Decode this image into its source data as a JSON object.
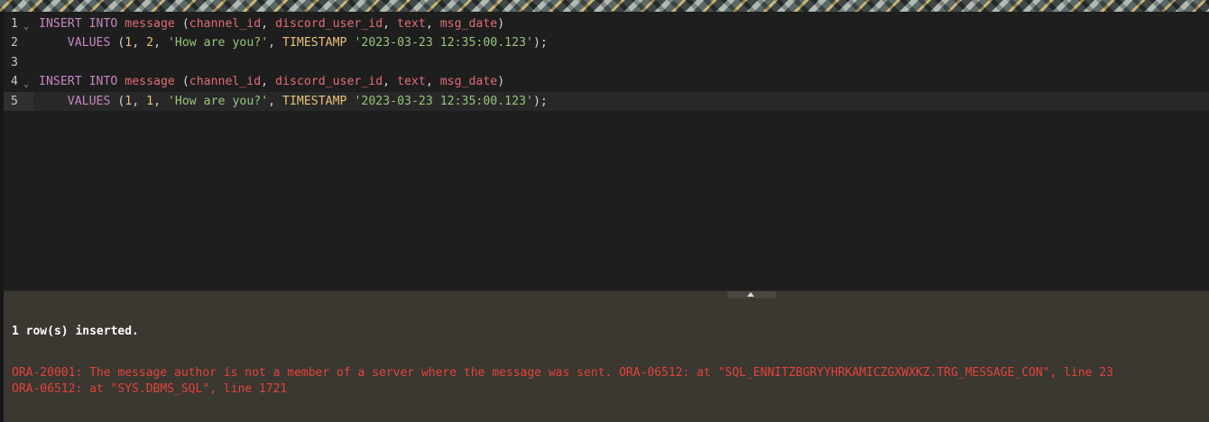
{
  "editor": {
    "lines": [
      {
        "number": "1",
        "fold": "⌄",
        "tokens": [
          "INSERT INTO",
          " ",
          "message",
          " (",
          "channel_id",
          ", ",
          "discord_user_id",
          ", ",
          "text",
          ", ",
          "msg_date",
          ")"
        ]
      },
      {
        "number": "2",
        "tokens": [
          "    ",
          "VALUES",
          " (",
          "1",
          ", ",
          "2",
          ", ",
          "'How are you?'",
          ", ",
          "TIMESTAMP",
          " ",
          "'2023-03-23 12:35:00.123'",
          ");"
        ]
      },
      {
        "number": "3",
        "tokens": []
      },
      {
        "number": "4",
        "fold": "⌄",
        "tokens": [
          "INSERT INTO",
          " ",
          "message",
          " (",
          "channel_id",
          ", ",
          "discord_user_id",
          ", ",
          "text",
          ", ",
          "msg_date",
          ")"
        ]
      },
      {
        "number": "5",
        "tokens": [
          "    ",
          "VALUES",
          " (",
          "1",
          ", ",
          "1",
          ", ",
          "'How are you?'",
          ", ",
          "TIMESTAMP",
          " ",
          "'2023-03-23 12:35:00.123'",
          ");"
        ]
      }
    ]
  },
  "output": {
    "success": "1 row(s) inserted.",
    "error_line1": "ORA-20001: The message author is not a member of a server where the message was sent. ORA-06512: at \"SQL_ENNITZBGRYYHRKAMICZGXWXKZ.TRG_MESSAGE_CON\", line 23",
    "error_line2": "ORA-06512: at \"SYS.DBMS_SQL\", line 1721"
  },
  "colors": {
    "keyword": "#c586c0",
    "timestamp_keyword": "#e5c07b",
    "identifier": "#e06c75",
    "number": "#e5c07b",
    "string": "#98c379",
    "error": "#e0443c",
    "output_background": "#3b3731"
  }
}
